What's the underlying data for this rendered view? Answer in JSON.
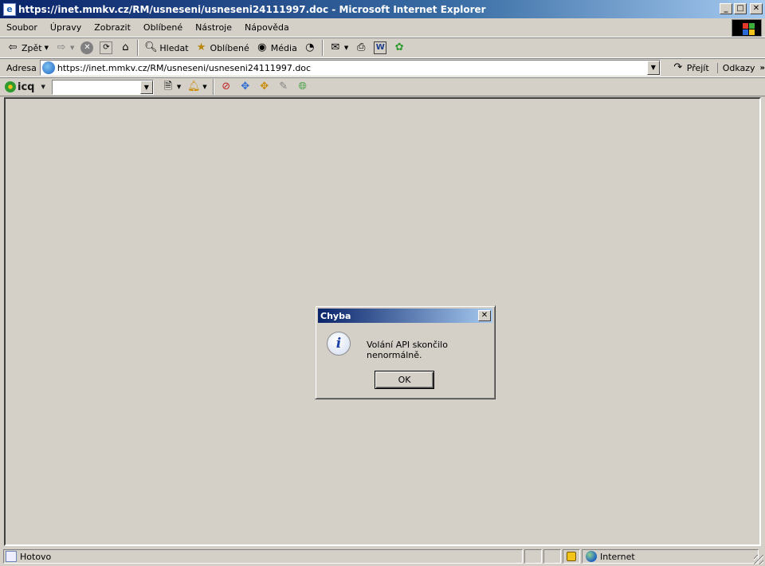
{
  "window": {
    "title": "https://inet.mmkv.cz/RM/usneseni/usneseni24111997.doc - Microsoft Internet Explorer",
    "minimize": "_",
    "maximize": "□",
    "close": "✕"
  },
  "menu": {
    "items": [
      "Soubor",
      "Úpravy",
      "Zobrazit",
      "Oblíbené",
      "Nástroje",
      "Nápověda"
    ]
  },
  "toolbar": {
    "back_label": "Zpět",
    "search_label": "Hledat",
    "favorites_label": "Oblíbené",
    "media_label": "Média"
  },
  "address": {
    "label": "Adresa",
    "url": "https://inet.mmkv.cz/RM/usneseni/usneseni24111997.doc",
    "go_label": "Přejít",
    "links_label": "Odkazy"
  },
  "icq": {
    "logo_text": "icq"
  },
  "dialog": {
    "title": "Chyba",
    "message": "Volání API skončilo nenormálně.",
    "ok_label": "OK"
  },
  "status": {
    "text": "Hotovo",
    "zone": "Internet"
  },
  "icons": [
    "ie-page-icon",
    "back-arrow-icon",
    "forward-arrow-icon",
    "stop-icon",
    "refresh-icon",
    "home-icon",
    "search-icon",
    "favorites-icon",
    "media-icon",
    "history-icon",
    "mail-icon",
    "print-icon",
    "edit-word-icon",
    "icq-pro-icon",
    "go-arrow-icon",
    "info-icon",
    "lock-icon",
    "globe-icon"
  ]
}
